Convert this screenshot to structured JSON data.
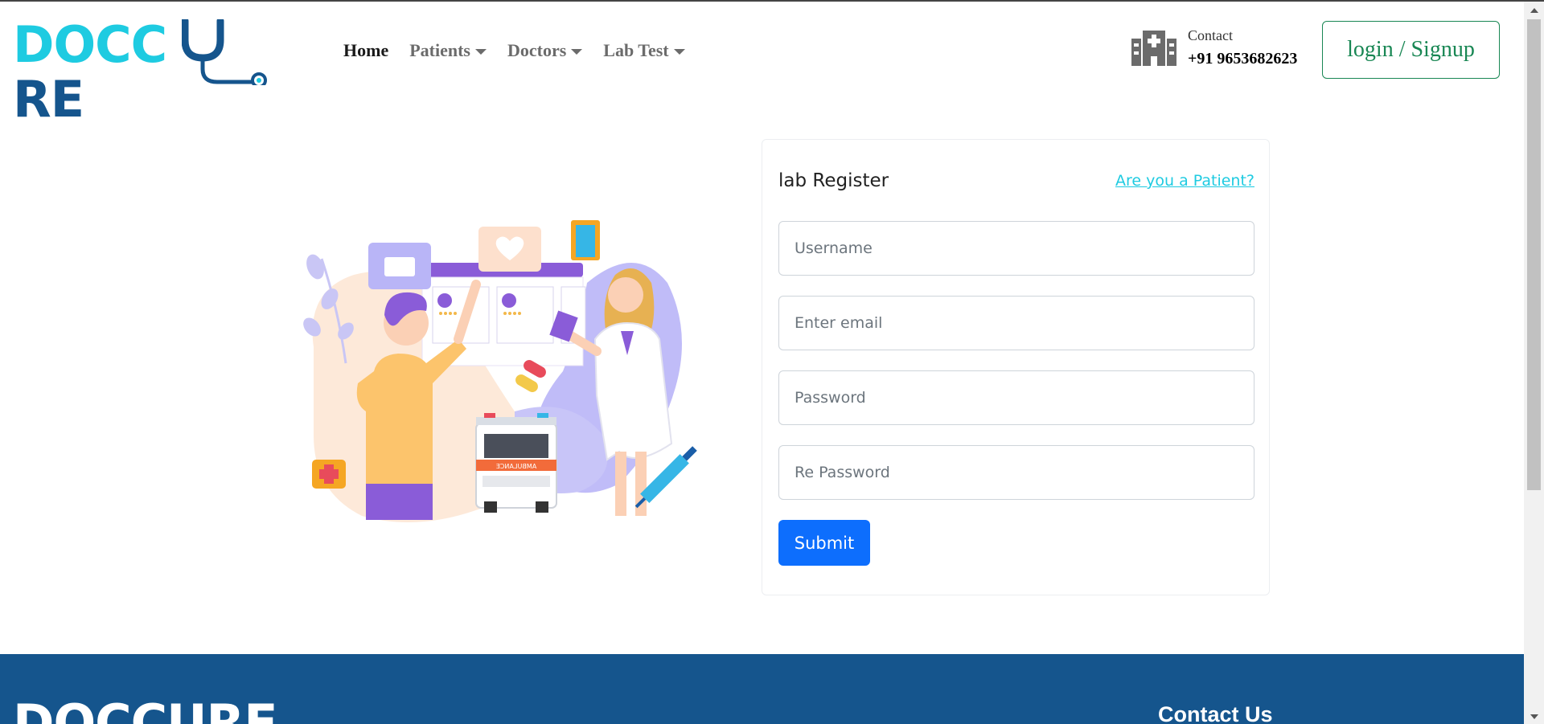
{
  "header": {
    "logo": {
      "part1": "DOCC",
      "part2": "RE"
    },
    "nav": [
      {
        "label": "Home",
        "dropdown": false
      },
      {
        "label": "Patients",
        "dropdown": true
      },
      {
        "label": "Doctors",
        "dropdown": true
      },
      {
        "label": "Lab Test",
        "dropdown": true
      }
    ],
    "contact_label": "Contact",
    "contact_phone": "+91 9653682623",
    "login_label": "login / Signup"
  },
  "register": {
    "title": "lab Register",
    "patient_link": "Are you a Patient?",
    "fields": {
      "username": {
        "placeholder": "Username",
        "value": ""
      },
      "email": {
        "placeholder": "Enter email",
        "value": ""
      },
      "password": {
        "placeholder": "Password",
        "value": ""
      },
      "repassword": {
        "placeholder": "Re Password",
        "value": ""
      }
    },
    "submit_label": "Submit"
  },
  "illustration": {
    "ambulance_text": "AMBULANCE"
  },
  "footer": {
    "logo": "DOCCURE",
    "contact_heading": "Contact Us"
  },
  "colors": {
    "brand_cyan": "#1ecbe1",
    "brand_blue": "#15558d",
    "login_green": "#198754",
    "submit_blue": "#0d6efd",
    "footer_bg": "#15558d"
  },
  "icons": [
    "stethoscope-icon",
    "hospital-icon",
    "caret-down-icon"
  ]
}
